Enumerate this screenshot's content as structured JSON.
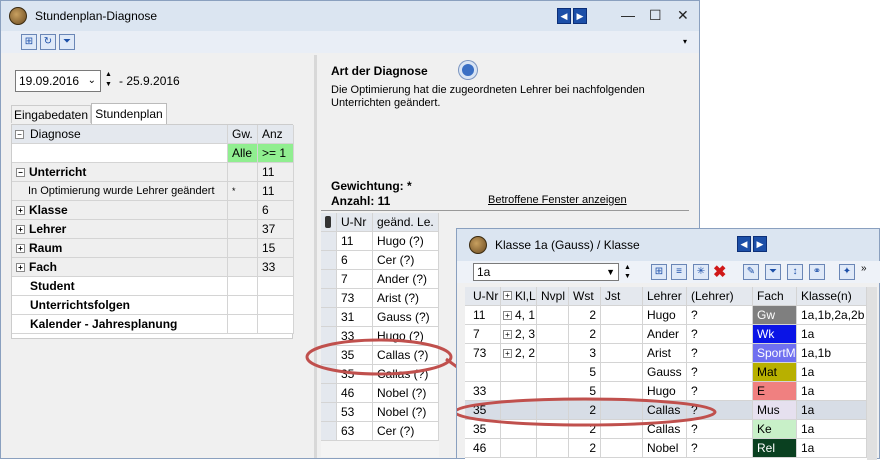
{
  "main_window": {
    "title": "Stundenplan-Diagnose",
    "date_from": "19.09.2016",
    "date_to": "- 25.9.2016",
    "tabs": [
      "Eingabedaten",
      "Stundenplan"
    ],
    "tree_headers": {
      "diagnose": "Diagnose",
      "gw": "Gw.",
      "anz": "Anz"
    },
    "filter_row": {
      "gw": "Alle",
      "anz": ">= 1"
    },
    "tree_rows": [
      {
        "label": "Unterricht",
        "gw": "",
        "anz": "11",
        "bold": true,
        "expander": "−"
      },
      {
        "label": "In Optimierung wurde Lehrer geändert",
        "gw": "*",
        "anz": "11",
        "bold": false,
        "expander": ""
      },
      {
        "label": "Klasse",
        "gw": "",
        "anz": "6",
        "bold": true,
        "expander": "+"
      },
      {
        "label": "Lehrer",
        "gw": "",
        "anz": "37",
        "bold": true,
        "expander": "+"
      },
      {
        "label": "Raum",
        "gw": "",
        "anz": "15",
        "bold": true,
        "expander": "+"
      },
      {
        "label": "Fach",
        "gw": "",
        "anz": "33",
        "bold": true,
        "expander": "+"
      },
      {
        "label": "Student",
        "gw": "",
        "anz": "",
        "bold": true,
        "expander": ""
      },
      {
        "label": "Unterrichtsfolgen",
        "gw": "",
        "anz": "",
        "bold": true,
        "expander": ""
      },
      {
        "label": "Kalender - Jahresplanung",
        "gw": "",
        "anz": "",
        "bold": true,
        "expander": ""
      }
    ],
    "detail": {
      "heading": "Art der Diagnose",
      "description": "Die Optimierung hat die zugeordneten Lehrer bei nachfolgenden Unterrichten geändert.",
      "weight": "Gewichtung: *",
      "count": "Anzahl: 11",
      "link": "Betroffene Fenster anzeigen"
    },
    "lesson_headers": {
      "unr": "U-Nr",
      "le": "geänd. Le."
    },
    "lessons": [
      {
        "unr": "11",
        "le": "Hugo (?)"
      },
      {
        "unr": "6",
        "le": "Cer (?)"
      },
      {
        "unr": "7",
        "le": "Ander (?)"
      },
      {
        "unr": "73",
        "le": "Arist (?)"
      },
      {
        "unr": "31",
        "le": "Gauss (?)"
      },
      {
        "unr": "33",
        "le": "Hugo (?)"
      },
      {
        "unr": "35",
        "le": "Callas (?)"
      },
      {
        "unr": "35",
        "le": "Callas (?)"
      },
      {
        "unr": "46",
        "le": "Nobel (?)"
      },
      {
        "unr": "53",
        "le": "Nobel (?)"
      },
      {
        "unr": "63",
        "le": "Cer (?)"
      }
    ]
  },
  "class_window": {
    "title": "Klasse 1a (Gauss) / Klasse",
    "selector": "1a",
    "headers": {
      "unr": "U-Nr",
      "kl": "Kl,Le",
      "nvpl": "Nvpl",
      "wst": "Wst",
      "jst": "Jst",
      "lehrer": "Lehrer",
      "lehrer2": "(Lehrer)",
      "fach": "Fach",
      "klasse": "Klasse(n)"
    },
    "rows": [
      {
        "unr": "11",
        "kl": "4, 1",
        "wst": "2",
        "lehrer": "Hugo",
        "l2": "?",
        "fach": "Gw",
        "fach_color": "#7f7f7f",
        "fach_text": "#ffffff",
        "klasse": "1a,1b,2a,2b"
      },
      {
        "unr": "7",
        "kl": "2, 3",
        "wst": "2",
        "lehrer": "Ander",
        "l2": "?",
        "fach": "Wk",
        "fach_color": "#0a14e6",
        "fach_text": "#ffffff",
        "klasse": "1a"
      },
      {
        "unr": "73",
        "kl": "2, 2",
        "wst": "3",
        "lehrer": "Arist",
        "l2": "?",
        "fach": "SportM",
        "fach_color": "#7070f0",
        "fach_text": "#ffffff",
        "klasse": "1a,1b"
      },
      {
        "unr": "",
        "kl": "",
        "wst": "5",
        "lehrer": "Gauss",
        "l2": "?",
        "fach": "Mat",
        "fach_color": "#b8b000",
        "fach_text": "#000000",
        "klasse": "1a"
      },
      {
        "unr": "33",
        "kl": "",
        "wst": "5",
        "lehrer": "Hugo",
        "l2": "?",
        "fach": "E",
        "fach_color": "#f08080",
        "fach_text": "#000000",
        "klasse": "1a"
      },
      {
        "unr": "35",
        "kl": "",
        "wst": "2",
        "lehrer": "Callas",
        "l2": "?",
        "fach": "Mus",
        "fach_color": "#e6e0ef",
        "fach_text": "#000000",
        "klasse": "1a"
      },
      {
        "unr": "35",
        "kl": "",
        "wst": "2",
        "lehrer": "Callas",
        "l2": "?",
        "fach": "Ke",
        "fach_color": "#c8f0c8",
        "fach_text": "#000000",
        "klasse": "1a"
      },
      {
        "unr": "46",
        "kl": "",
        "wst": "2",
        "lehrer": "Nobel",
        "l2": "?",
        "fach": "Rel",
        "fach_color": "#0a4020",
        "fach_text": "#ffffff",
        "klasse": "1a"
      }
    ]
  },
  "colors": {
    "filter_green": "#90ee90",
    "highlight_oval": "#c0504d",
    "selected_row": "#d7dde6"
  }
}
